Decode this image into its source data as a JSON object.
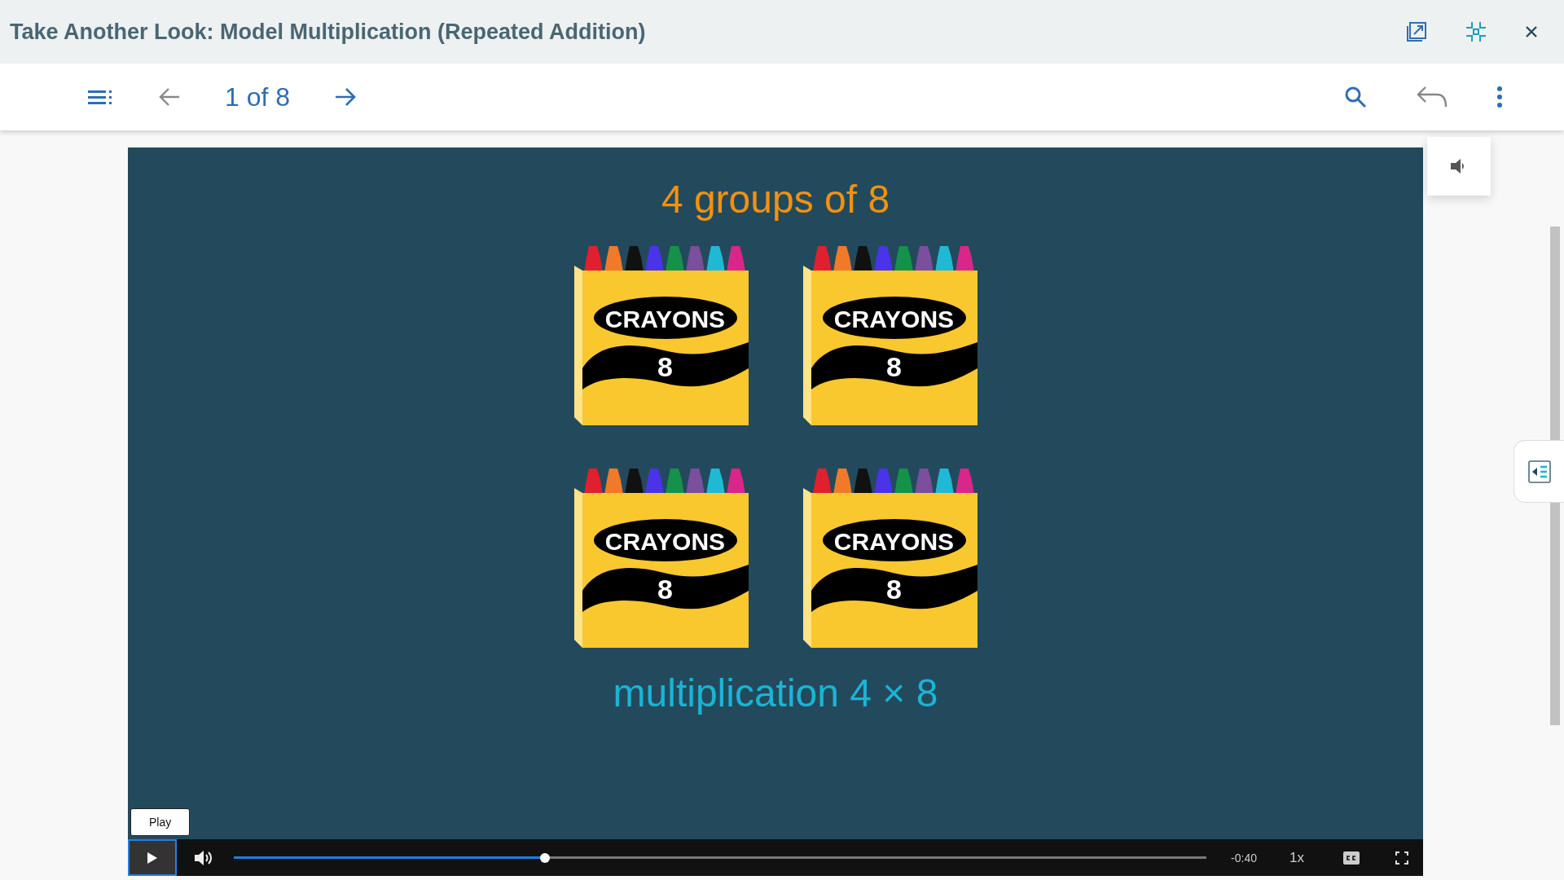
{
  "window": {
    "title": "Take Another Look: Model Multiplication (Repeated Addition)"
  },
  "toolbar": {
    "page_indicator": "1 of 8"
  },
  "slide": {
    "heading": "4 groups of 8",
    "boxes": [
      {
        "label": "CRAYONS",
        "count": "8"
      },
      {
        "label": "CRAYONS",
        "count": "8"
      },
      {
        "label": "CRAYONS",
        "count": "8"
      },
      {
        "label": "CRAYONS",
        "count": "8"
      }
    ],
    "caption": "multiplication 4 × 8"
  },
  "player": {
    "tooltip": "Play",
    "progress": {
      "level": 0.32
    },
    "time_remaining": "-0:40",
    "speed": "1x"
  }
}
